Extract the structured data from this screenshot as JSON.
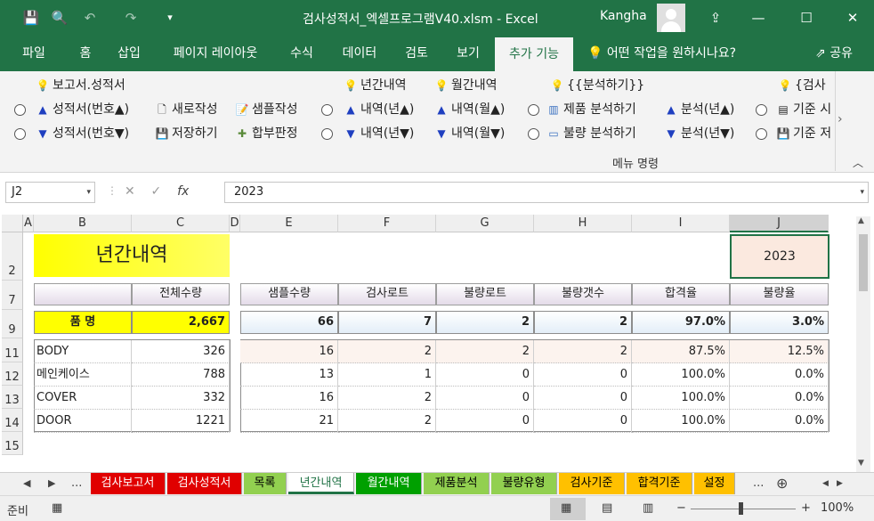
{
  "titlebar": {
    "title": "검사성적서_엑셀프로그램V40.xlsm  -  Excel",
    "user": "Kangha",
    "save_icon": "💾",
    "preview_icon": "🔍",
    "undo_icon": "↶",
    "redo_icon": "↷",
    "customize_icon": "▾",
    "ribbon_display_icon": "⇪",
    "minimize_icon": "—",
    "maximize_icon": "☐",
    "close_icon": "✕"
  },
  "menu": {
    "tabs": [
      "파일",
      "홈",
      "삽입",
      "페이지 레이아웃",
      "수식",
      "데이터",
      "검토",
      "보기",
      "추가 기능"
    ],
    "tell_me": "어떤 작업을 원하시나요?",
    "share": "공유",
    "lightbulb_icon": "💡",
    "share_icon": "⇗"
  },
  "ribbon": {
    "group1_title": "보고서.성적서",
    "report_asc": "성적서(번호▲)",
    "report_desc": "성적서(번호▼)",
    "new_write": "새로작성",
    "sample_write": "샘플작성",
    "save": "저장하기",
    "pass_fail": "합부판정",
    "year_title": "년간내역",
    "year_asc": "내역(년▲)",
    "year_desc": "내역(년▼)",
    "month_title": "월간내역",
    "month_asc": "내역(월▲)",
    "month_desc": "내역(월▼)",
    "analysis_title": "{{분석하기}}",
    "product_analysis": "제품 분석하기",
    "defect_analysis": "불량 분석하기",
    "analysis_year_asc": "분석(년▲)",
    "analysis_year_desc": "분석(년▼)",
    "inspect_title": "{검사",
    "criteria1": "기준 시",
    "criteria2": "기준 저",
    "footer": "메뉴 명령",
    "bulb_icon": "💡",
    "up_icon": "▲",
    "down_icon": "▼",
    "collapse_icon": "︿",
    "scroll_right_icon": "›"
  },
  "formula_bar": {
    "cell_ref": "J2",
    "value": "2023",
    "cancel_icon": "✕",
    "enter_icon": "✓",
    "fx_label": "fx",
    "dropdown_icon": "▾"
  },
  "grid": {
    "columns": [
      "A",
      "B",
      "C",
      "D",
      "E",
      "F",
      "G",
      "H",
      "I",
      "J"
    ],
    "rows": [
      "2",
      "7",
      "9",
      "11",
      "12",
      "13",
      "14",
      "15"
    ],
    "title": "년간내역",
    "year": "2023",
    "headers": {
      "total_qty": "전체수량",
      "sample_qty": "샘플수량",
      "lot": "검사로트",
      "defect_lot": "불량로트",
      "defect_count": "불량갯수",
      "pass_rate": "합격율",
      "defect_rate": "불량율"
    },
    "summary": {
      "label": "품  명",
      "total_qty": "2,667",
      "sample_qty": "66",
      "lot": "7",
      "defect_lot": "2",
      "defect_count": "2",
      "pass_rate": "97.0%",
      "defect_rate": "3.0%"
    },
    "rows_data": [
      {
        "name": "BODY",
        "total": "326",
        "sample": "16",
        "lot": "2",
        "defect_lot": "2",
        "defect_count": "2",
        "pass": "87.5%",
        "defect": "12.5%"
      },
      {
        "name": "메인케이스",
        "total": "788",
        "sample": "13",
        "lot": "1",
        "defect_lot": "0",
        "defect_count": "0",
        "pass": "100.0%",
        "defect": "0.0%"
      },
      {
        "name": "COVER",
        "total": "332",
        "sample": "16",
        "lot": "2",
        "defect_lot": "0",
        "defect_count": "0",
        "pass": "100.0%",
        "defect": "0.0%"
      },
      {
        "name": "DOOR",
        "total": "1221",
        "sample": "21",
        "lot": "2",
        "defect_lot": "0",
        "defect_count": "0",
        "pass": "100.0%",
        "defect": "0.0%"
      }
    ]
  },
  "sheets": {
    "tabs": [
      {
        "label": "검사보고서",
        "bg": "#e00000",
        "fg": "#ffffff"
      },
      {
        "label": "검사성적서",
        "bg": "#e00000",
        "fg": "#ffffff"
      },
      {
        "label": "목록",
        "bg": "#92d050",
        "fg": "#000000"
      },
      {
        "label": "년간내역",
        "bg": "#ffffff",
        "fg": "#217346"
      },
      {
        "label": "월간내역",
        "bg": "#00a000",
        "fg": "#ffffff"
      },
      {
        "label": "제품분석",
        "bg": "#92d050",
        "fg": "#000000"
      },
      {
        "label": "불량유형",
        "bg": "#92d050",
        "fg": "#000000"
      },
      {
        "label": "검사기준",
        "bg": "#ffc000",
        "fg": "#000000"
      },
      {
        "label": "합격기준",
        "bg": "#ffc000",
        "fg": "#000000"
      },
      {
        "label": "설정",
        "bg": "#ffc000",
        "fg": "#000000"
      }
    ],
    "more": "...",
    "add_icon": "⊕",
    "prev_icon": "◀",
    "next_icon": "▶"
  },
  "status": {
    "ready": "준비",
    "zoom": "100%",
    "minus": "−",
    "plus": "+",
    "macro_icon": "▦",
    "normal_view_icon": "▦",
    "page_layout_icon": "▤",
    "page_break_icon": "▥"
  },
  "colors": {
    "accent": "#217346",
    "title_fill": "#ffff00",
    "header_fill": "#e4dbe9",
    "year_fill": "#fbe9df"
  }
}
